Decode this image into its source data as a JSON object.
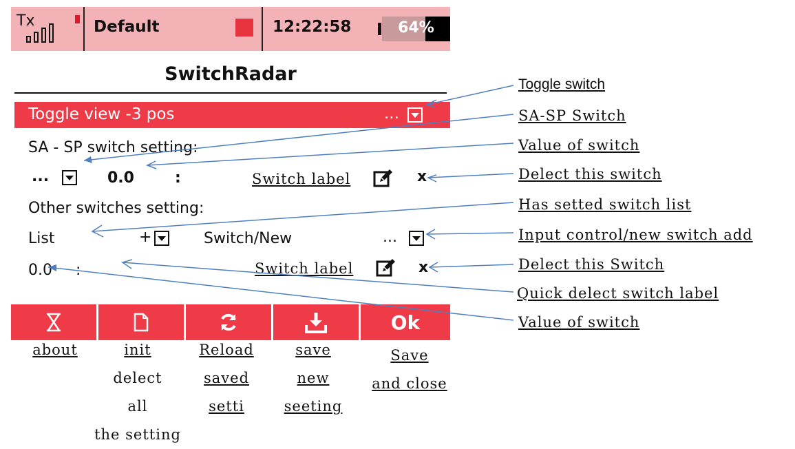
{
  "status_bar": {
    "tx_label": "Tx",
    "signal_bars": 4,
    "model_name": "Default",
    "time": "12:22:58",
    "battery_percent": 64,
    "battery_text": "64%"
  },
  "screen": {
    "title": "SwitchRadar",
    "toggle_row": {
      "label": "Toggle view -3 pos",
      "dots": "..."
    },
    "sa_sp_heading": "SA - SP switch setting:",
    "sa_sp_row": {
      "dots": "...",
      "value": "0.0",
      "colon": ":",
      "switch_label": "Switch label",
      "delete": "x"
    },
    "other_heading": "Other switches setting:",
    "list_row": {
      "list": "List",
      "plus": "+",
      "switch_new": "Switch/New",
      "dots": "..."
    },
    "value_row": {
      "value": "0.0",
      "colon": ":",
      "switch_label": "Switch label",
      "delete": "x"
    },
    "footer": {
      "ok": "Ok"
    }
  },
  "annotations": {
    "toggle_switch": "Toggle switch",
    "sa_sp_switch": "SA-SP Switch",
    "value_of_switch_1": "Value of switch",
    "delect_this_switch_1": "Delect this switch",
    "has_setted_switch_list": "Has setted switch list",
    "input_control": "Input control/new switch add",
    "delect_this_switch_2": "Delect this Switch",
    "quick_delect": "Quick delect switch label",
    "value_of_switch_2": "Value of switch"
  },
  "captions": {
    "about": "about",
    "init_1": "init",
    "init_2": "delect",
    "init_3": "all",
    "init_4": "the setting",
    "reload_1": "Reload",
    "reload_2": "saved",
    "reload_3": "setti",
    "save_1": "save",
    "save_2": "new",
    "save_3": "seeting",
    "saveclose_1": "Save",
    "saveclose_2": "and close"
  },
  "colors": {
    "status_bg": "#f3b3b6",
    "accent_red": "#ef3a48",
    "arrow_blue": "#4f7fbf"
  },
  "icons": {
    "about": "hourglass-icon",
    "init": "file-icon",
    "reload": "refresh-icon",
    "save": "download-icon",
    "edit": "pencil-icon"
  }
}
